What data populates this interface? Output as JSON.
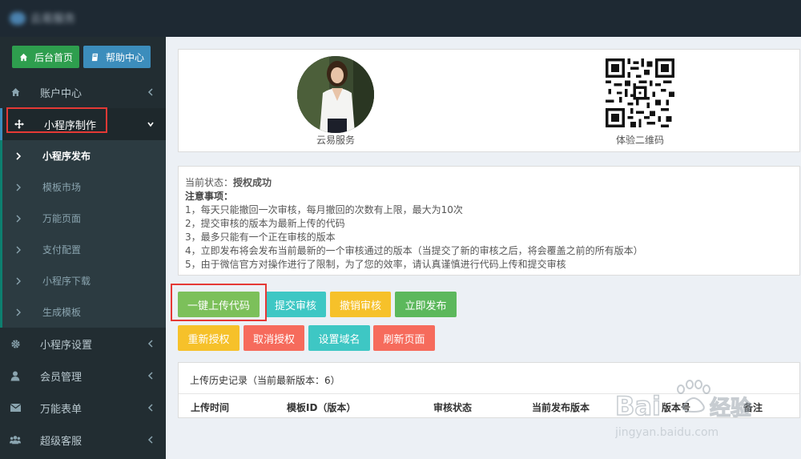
{
  "app": {
    "logo_text": "云易服务"
  },
  "quick": {
    "home": "后台首页",
    "help": "帮助中心"
  },
  "sidebar": {
    "account": "账户中心",
    "miniapp_make": "小程序制作",
    "subs": [
      "小程序发布",
      "模板市场",
      "万能页面",
      "支付配置",
      "小程序下载",
      "生成模板"
    ],
    "miniapp_settings": "小程序设置",
    "members": "会员管理",
    "forms": "万能表单",
    "service": "超级客服"
  },
  "profile": {
    "name": "云易服务",
    "qr_label": "体验二维码"
  },
  "notice": {
    "status_label": "当前状态：",
    "status_value": "授权成功",
    "note_title": "注意事项：",
    "lines": [
      "1，每天只能撤回一次审核，每月撤回的次数有上限，最大为10次",
      "2，提交审核的版本为最新上传的代码",
      "3，最多只能有一个正在审核的版本",
      "4，立即发布将会发布当前最新的一个审核通过的版本（当提交了新的审核之后，将会覆盖之前的所有版本）",
      "5，由于微信官方对操作进行了限制，为了您的效率，请认真谨慎进行代码上传和提交审核"
    ]
  },
  "actions": {
    "upload": "一键上传代码",
    "submit": "提交审核",
    "revoke": "撤销审核",
    "publish": "立即发布",
    "reauth": "重新授权",
    "cancel_auth": "取消授权",
    "domain": "设置域名",
    "refresh": "刷新页面"
  },
  "history": {
    "title": "上传历史记录（当前最新版本：6）",
    "columns": [
      "上传时间",
      "模板ID（版本）",
      "审核状态",
      "当前发布版本",
      "版本号",
      "备注"
    ]
  },
  "watermark": {
    "brand": "Bai",
    "brand2": "经验",
    "url": "jingyan.baidu.com"
  },
  "colors": {
    "sidebar": "#222d32",
    "topbar": "#1e2933",
    "olive": "#7cc05a",
    "teal": "#3ec7c4",
    "yellow": "#f6c12a",
    "green": "#5cb85c",
    "red": "#f66b5c",
    "highlight": "#e53935"
  }
}
